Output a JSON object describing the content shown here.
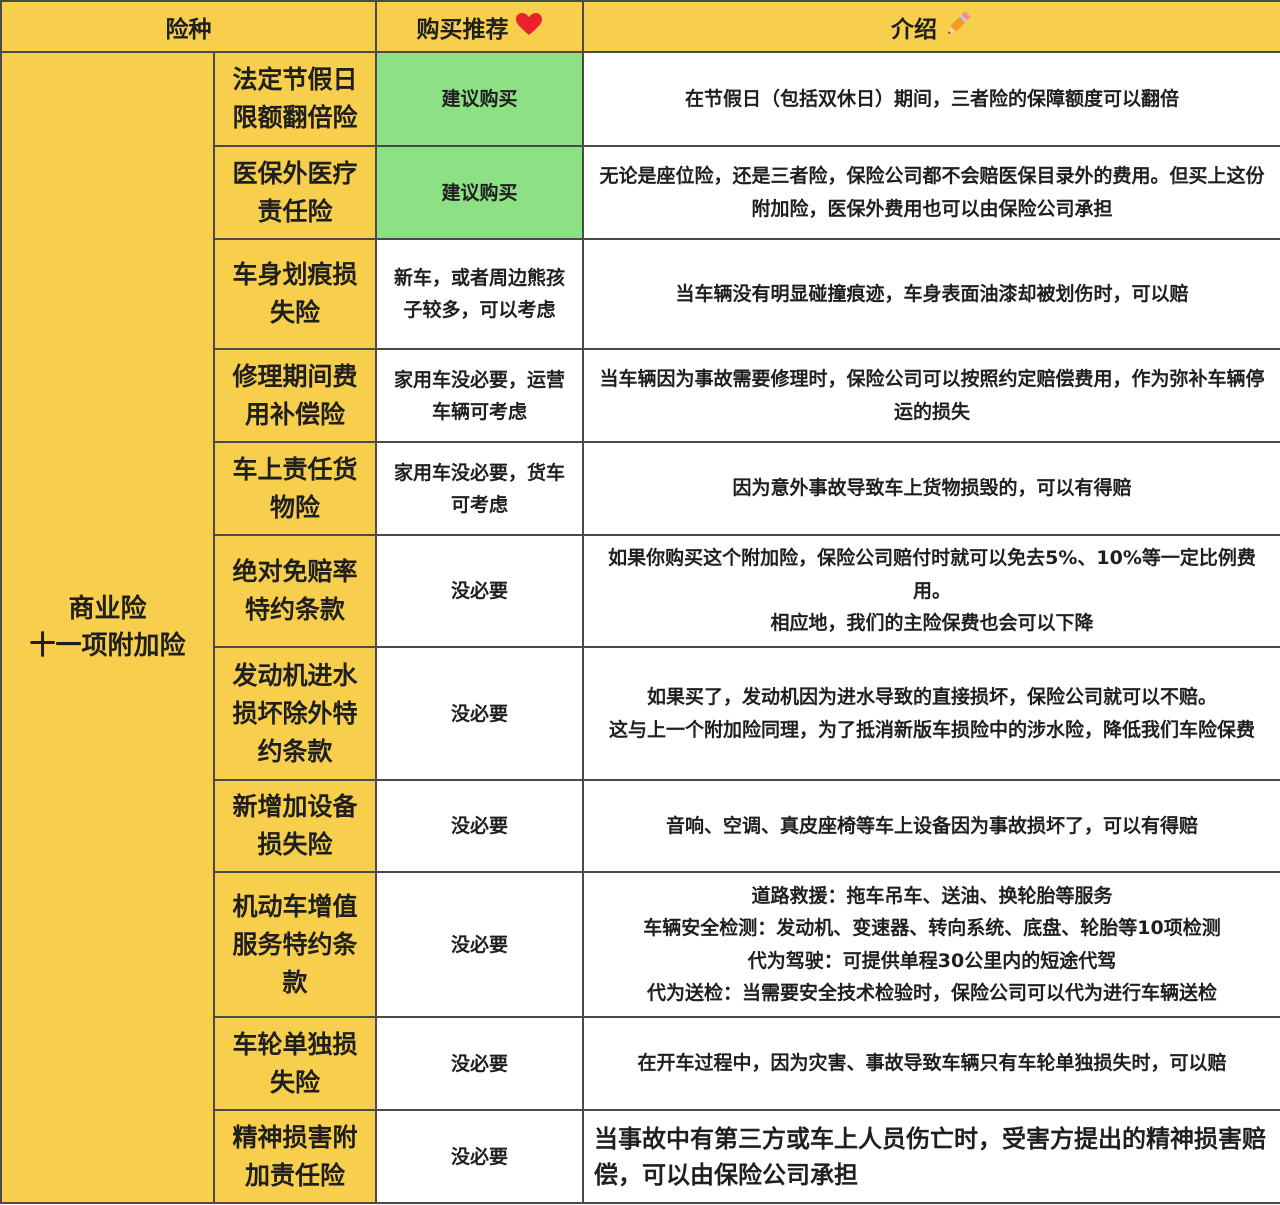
{
  "header": {
    "col_type": "险种",
    "col_recommend": "购买推荐",
    "col_intro": "介绍",
    "recommend_icon": "heart-icon",
    "intro_icon": "pencil-icon",
    "heart_color": "#e8212b"
  },
  "category": {
    "line1": "商业险",
    "line2": "十一项附加险"
  },
  "colors": {
    "header_bg": "#f7cf4d",
    "name_bg": "#f7cf4d",
    "recommended_bg": "#8ee085",
    "border": "#4a4a4a"
  },
  "rows": [
    {
      "name": "法定节假日限额翻倍险",
      "recommend": "建议购买",
      "intro": "在节假日（包括双休日）期间，三者险的保障额度可以翻倍"
    },
    {
      "name": "医保外医疗责任险",
      "recommend": "建议购买",
      "intro": "无论是座位险，还是三者险，保险公司都不会赔医保目录外的费用。但买上这份附加险，医保外费用也可以由保险公司承担"
    },
    {
      "name": "车身划痕损失险",
      "recommend": "新车，或者周边熊孩子较多，可以考虑",
      "intro": "当车辆没有明显碰撞痕迹，车身表面油漆却被划伤时，可以赔"
    },
    {
      "name": "修理期间费用补偿险",
      "recommend": "家用车没必要，运营车辆可考虑",
      "intro": "当车辆因为事故需要修理时，保险公司可以按照约定赔偿费用，作为弥补车辆停运的损失"
    },
    {
      "name": "车上责任货物险",
      "recommend": "家用车没必要，货车可考虑",
      "intro": "因为意外事故导致车上货物损毁的，可以有得赔"
    },
    {
      "name": "绝对免赔率特约条款",
      "recommend": "没必要",
      "intro": "如果你购买这个附加险，保险公司赔付时就可以免去5%、10%等一定比例费用。",
      "intro2": "相应地，我们的主险保费也会可以下降"
    },
    {
      "name": "发动机进水损坏除外特约条款",
      "recommend": "没必要",
      "intro": "如果买了，发动机因为进水导致的直接损坏，保险公司就可以不赔。",
      "intro2": "这与上一个附加险同理，为了抵消新版车损险中的涉水险，降低我们车险保费"
    },
    {
      "name": "新增加设备损失险",
      "recommend": "没必要",
      "intro": "音响、空调、真皮座椅等车上设备因为事故损坏了，可以有得赔"
    },
    {
      "name": "机动车增值服务特约条款",
      "recommend": "没必要",
      "intro_lines": [
        "道路救援：拖车吊车、送油、换轮胎等服务",
        "车辆安全检测：发动机、变速器、转向系统、底盘、轮胎等10项检测",
        "代为驾驶：可提供单程30公里内的短途代驾",
        "代为送检：当需要安全技术检验时，保险公司可以代为进行车辆送检"
      ]
    },
    {
      "name": "车轮单独损失险",
      "recommend": "没必要",
      "intro": "在开车过程中，因为灾害、事故导致车辆只有车轮单独损失时，可以赔"
    },
    {
      "name": "精神损害附加责任险",
      "recommend": "没必要",
      "intro": "当事故中有第三方或车上人员伤亡时，受害方提出的精神损害赔偿，可以由保险公司承担"
    }
  ]
}
